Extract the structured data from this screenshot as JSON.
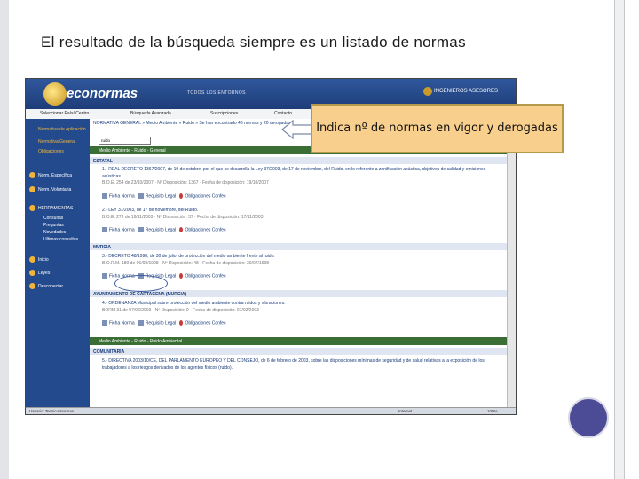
{
  "slide": {
    "title": "El resultado de la búsqueda siempre es un listado de normas",
    "callout": "Indica nº de normas en vigor y derogadas"
  },
  "app": {
    "logo": "econormas",
    "center_header": "TODOS LOS ENTORNOS",
    "right_header": "INGENIEROS ASESORES",
    "menu": [
      "Seleccionar País/ Centro",
      "Búsqueda Avanzada",
      "Suscripciones",
      "Contacto"
    ],
    "sidebar": [
      {
        "label": "Normativa de Aplicación",
        "highlight": true
      },
      {
        "label": "Normativa General",
        "highlight": true
      },
      {
        "label": "Obligaciones",
        "highlight": true
      },
      {
        "label": "Norm. Específica",
        "highlight": false
      },
      {
        "label": "Norm. Voluntaria",
        "highlight": false
      },
      {
        "label": "HERRAMIENTAS",
        "highlight": false
      },
      {
        "label": "Consultas",
        "highlight": false
      },
      {
        "label": "Preguntas",
        "highlight": false
      },
      {
        "label": "Novedades",
        "highlight": false
      },
      {
        "label": "Ultimas consultas",
        "highlight": false
      },
      {
        "label": "Inicio",
        "highlight": false
      },
      {
        "label": "Leyes",
        "highlight": false
      },
      {
        "label": "Desconectar",
        "highlight": false
      }
    ],
    "breadcrumb": "NORMATIVA GENERAL » Medio Ambiente » Ruido » Se han encontrado 46 normas y 20 derogadas",
    "search_value": "ruido",
    "path_bars": [
      "Medio Ambiente - Ruido - General",
      "Medio Ambiente - Ruido - Ruido Ambiental"
    ],
    "sections": [
      "ESTATAL",
      "MURCIA",
      "AYUNTAMIENTO DE CARTAGENA (MURCIA)",
      "COMUNITARIA"
    ],
    "entries": [
      {
        "title": "1.- REAL DECRETO 1367/2007, de 19 de octubre, por el que se desarrolla la Ley 37/2003, de 17 de noviembre, del Ruido, en lo referente a zonificación acústica, objetivos de calidad y emisiones acústicas.",
        "meta": "B.O.E. 254 de 23/10/2007 · Nº Disposición: 1367 · Fecha de disposición: 19/10/2007"
      },
      {
        "title": "2.- LEY 37/2003, de 17 de noviembre, del Ruido.",
        "meta": "B.O.E. 276 de 18/11/2003 · Nº Disposición: 37 · Fecha de disposición: 17/11/2003"
      },
      {
        "title": "3.- DECRETO 48/1998, de 30 de julio, de protección del medio ambiente frente al ruido.",
        "meta": "B.O.R.M. 180 de 06/08/1998 · Nº Disposición: 48 · Fecha de disposición: 30/07/1998"
      },
      {
        "title": "4.- ORDENANZA Municipal sobre protección del medio ambiente contra ruidos y vibraciones.",
        "meta": "BORM 31 de 07/02/2003 · Nº Disposición: 0 · Fecha de disposición: 07/02/2003"
      },
      {
        "title": "5.- DIRECTIVA 2003/10/CE, DEL PARLAMENTO EUROPEO Y DEL CONSEJO, de 6 de febrero de 2003, sobre las disposiciones mínimas de seguridad y de salud relativas a la exposición de los trabajadores a los riesgos derivados de los agentes físicos (ruido).",
        "meta": ""
      }
    ],
    "links": [
      "Ficha Norma",
      "Requisito Legal",
      "Obligaciones Confec"
    ],
    "status_left": "Usuario: Tecnico Normas",
    "status_mid": "Internet",
    "status_right": "100%"
  }
}
